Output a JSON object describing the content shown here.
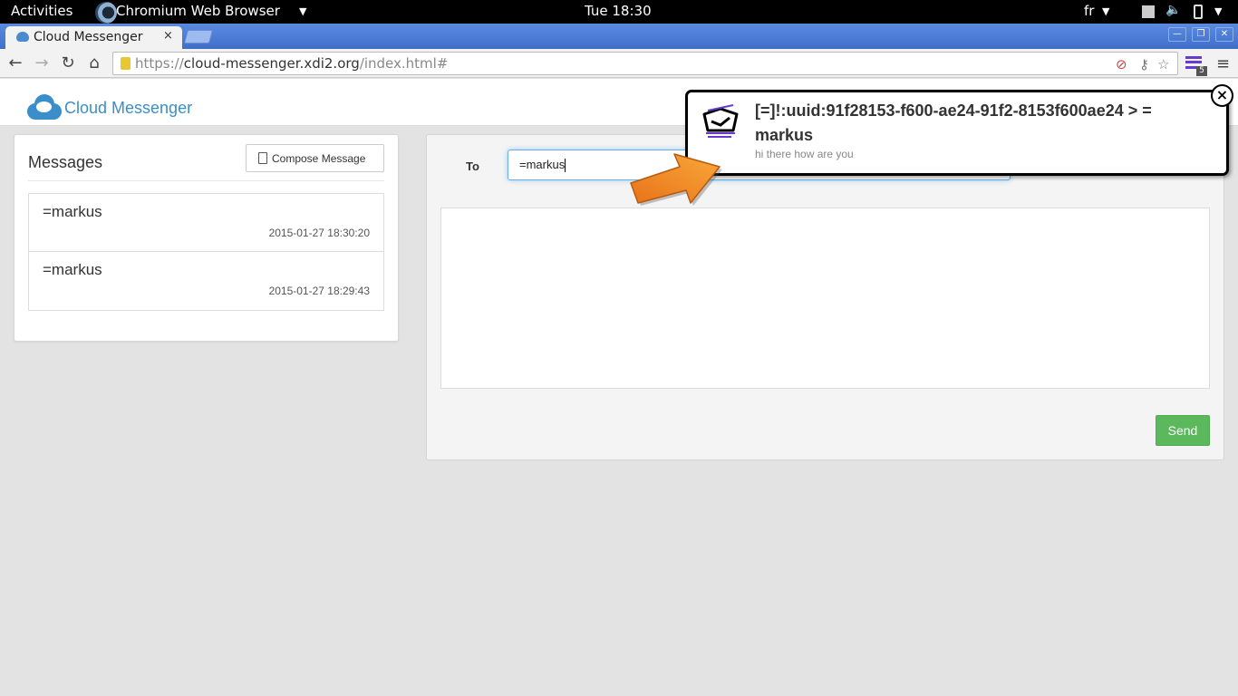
{
  "desktop": {
    "activities": "Activities",
    "app_name": "Chromium Web Browser",
    "clock": "Tue 18:30",
    "keyboard_layout": "fr"
  },
  "browser": {
    "tab_title": "Cloud Messenger",
    "tab_close": "×",
    "url_scheme": "https://",
    "url_host": "cloud-messenger.xdi2.org",
    "url_path": "/index.html#",
    "extension_badge": "5"
  },
  "app": {
    "brand": "Cloud Messenger",
    "brand_color": "#3a8ec9"
  },
  "messages_panel": {
    "heading": "Messages",
    "compose_label": "Compose Message",
    "items": [
      {
        "from": "=markus",
        "time": "2015-01-27 18:30:20"
      },
      {
        "from": "=markus",
        "time": "2015-01-27 18:29:43"
      }
    ]
  },
  "compose_form": {
    "to_label": "To",
    "to_value": "=markus",
    "body_value": "",
    "send_label": "Send",
    "send_color": "#5cb85c"
  },
  "notification": {
    "title": "[=]!:uuid:91f28153-f600-ae24-91f2-8153f600ae24  >  =markus",
    "body": "hi there how are you",
    "close_label": "×"
  },
  "icons": [
    "cloud-icon",
    "document-icon",
    "back-icon",
    "forward-icon",
    "reload-icon",
    "home-icon",
    "lock-icon",
    "star-icon",
    "menu-icon",
    "close-icon",
    "arrow-pointer-icon",
    "envelope-icon"
  ]
}
